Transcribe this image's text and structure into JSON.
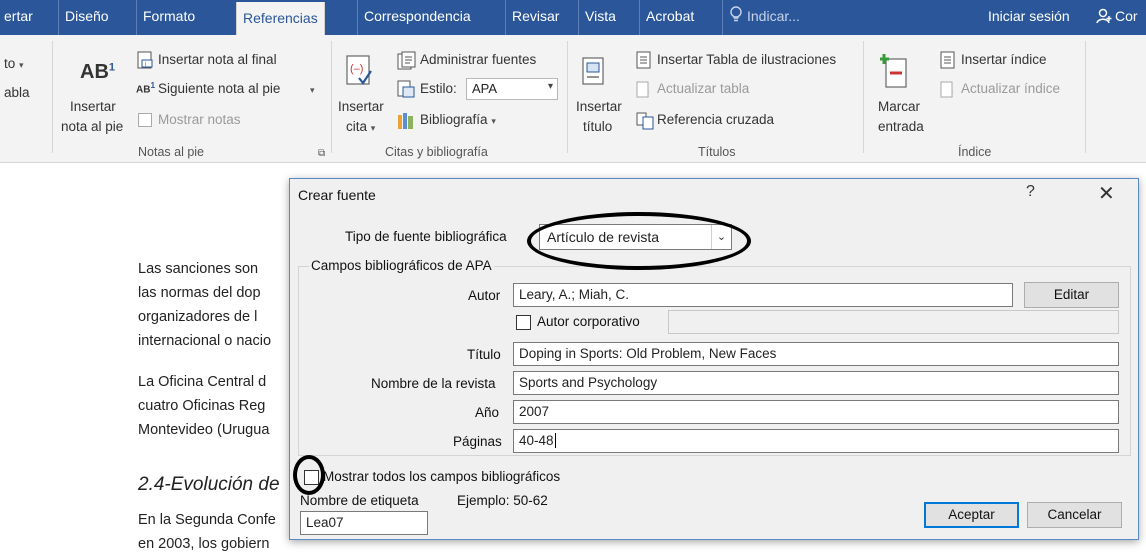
{
  "tabs": [
    {
      "label": "ertar"
    },
    {
      "label": "Diseño"
    },
    {
      "label": "Formato"
    },
    {
      "label": "Referencias"
    },
    {
      "label": "Correspondencia"
    },
    {
      "label": "Revisar"
    },
    {
      "label": "Vista"
    },
    {
      "label": "Acrobat"
    },
    {
      "label": "Indicar..."
    },
    {
      "label": "Iniciar sesión"
    },
    {
      "label": "Cor"
    }
  ],
  "ribbon": {
    "left_partial": {
      "line1": "to",
      "line2": "abla"
    },
    "notas_al_pie": {
      "insertar_nota_label_1": "Insertar",
      "insertar_nota_label_2": "nota al pie",
      "insertar_nota_final": "Insertar nota al final",
      "siguiente_nota": "Siguiente nota al pie",
      "mostrar_notas": "Mostrar notas",
      "group_label": "Notas al pie"
    },
    "citas": {
      "insertar_cita_1": "Insertar",
      "insertar_cita_2": "cita",
      "administrar_fuentes": "Administrar fuentes",
      "estilo_label": "Estilo:",
      "estilo_value": "APA",
      "bibliografia": "Bibliografía",
      "group_label": "Citas y bibliografía"
    },
    "titulos": {
      "insertar_titulo_1": "Insertar",
      "insertar_titulo_2": "título",
      "insertar_tabla_ilustraciones": "Insertar Tabla de ilustraciones",
      "actualizar_tabla": "Actualizar tabla",
      "referencia_cruzada": "Referencia cruzada",
      "group_label": "Títulos"
    },
    "indice": {
      "marcar_entrada_1": "Marcar",
      "marcar_entrada_2": "entrada",
      "insertar_indice": "Insertar índice",
      "actualizar_indice": "Actualizar índice",
      "group_label": "Índice"
    }
  },
  "document": {
    "lines": [
      "Las sanciones son",
      "las normas del dop",
      "organizadores de l",
      "internacional o nacio",
      "La Oficina Central d",
      "cuatro Oficinas Reg",
      "Montevideo (Urugua",
      "En la Segunda Confe",
      "en 2003, los gobiern"
    ],
    "heading": "2.4-Evolución de"
  },
  "dialog": {
    "title": "Crear fuente",
    "help": "?",
    "close": "✕",
    "tipo_label": "Tipo de fuente bibliográfica",
    "tipo_value": "Artículo de revista",
    "fieldset_legend": "Campos bibliográficos de APA",
    "autor_label": "Autor",
    "autor_value": "Leary, A.; Miah, C.",
    "editar_button": "Editar",
    "autor_corporativo_label": "Autor corporativo",
    "titulo_label": "Título",
    "titulo_value": "Doping in Sports: Old Problem, New Faces",
    "revista_label": "Nombre de la revista",
    "revista_value": "Sports and Psychology",
    "anio_label": "Año",
    "anio_value": "2007",
    "paginas_label": "Páginas",
    "paginas_value": "40-48",
    "mostrar_todos_label": "Mostrar todos los campos bibliográficos",
    "etiqueta_label": "Nombre de etiqueta",
    "ejemplo_label": "Ejemplo: 50-62",
    "etiqueta_value": "Lea07",
    "aceptar_button": "Aceptar",
    "cancelar_button": "Cancelar"
  },
  "colors": {
    "ribbon_tab_bg": "#2b579a",
    "ribbon_bg": "#f3f3f3",
    "dialog_bg": "#f0f0f0",
    "dialog_border": "#5a8ac6",
    "default_button_border": "#0078d7"
  }
}
